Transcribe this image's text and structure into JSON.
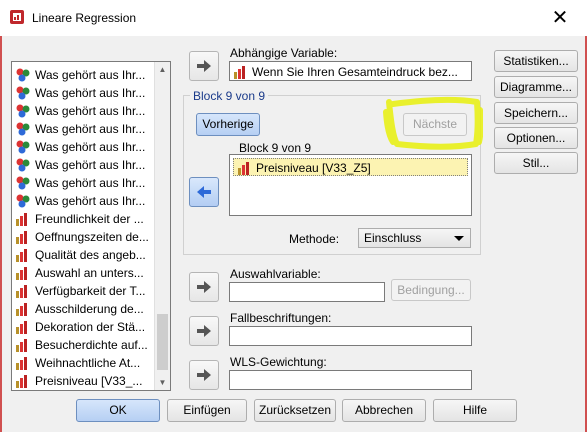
{
  "window": {
    "title": "Lineare Regression",
    "close_glyph": "✕"
  },
  "variable_list": {
    "items": [
      {
        "label": "Was gehört aus Ihr...",
        "icon": "ordinal-icon"
      },
      {
        "label": "Was gehört aus Ihr...",
        "icon": "ordinal-icon"
      },
      {
        "label": "Was gehört aus Ihr...",
        "icon": "ordinal-icon"
      },
      {
        "label": "Was gehört aus Ihr...",
        "icon": "ordinal-icon"
      },
      {
        "label": "Was gehört aus Ihr...",
        "icon": "ordinal-icon"
      },
      {
        "label": "Was gehört aus Ihr...",
        "icon": "ordinal-icon"
      },
      {
        "label": "Was gehört aus Ihr...",
        "icon": "ordinal-icon"
      },
      {
        "label": "Was gehört aus Ihr...",
        "icon": "ordinal-icon"
      },
      {
        "label": "Freundlichkeit der ...",
        "icon": "scale-icon"
      },
      {
        "label": "Oeffnungszeiten de...",
        "icon": "scale-icon"
      },
      {
        "label": "Qualität des angeb...",
        "icon": "scale-icon"
      },
      {
        "label": "Auswahl an unters...",
        "icon": "scale-icon"
      },
      {
        "label": "Verfügbarkeit  der T...",
        "icon": "scale-icon"
      },
      {
        "label": "Ausschilderung de...",
        "icon": "scale-icon"
      },
      {
        "label": "Dekoration der Stä...",
        "icon": "scale-icon"
      },
      {
        "label": "Besucherdichte auf...",
        "icon": "scale-icon"
      },
      {
        "label": "Weihnachtliche At...",
        "icon": "scale-icon"
      },
      {
        "label": "Preisniveau  [V33_...",
        "icon": "scale-icon"
      }
    ]
  },
  "dependent": {
    "label": "Abhängige Variable:",
    "value": "Wenn Sie Ihren Gesamteindruck bez...",
    "icon": "scale-icon"
  },
  "block": {
    "legend": "Block 9 von 9",
    "prev_label": "Vorherige",
    "next_label": "Nächste",
    "list_label": "Block 9 von 9",
    "selected_item": "Preisniveau  [V33_Z5]",
    "method_label": "Methode:",
    "method_value": "Einschluss"
  },
  "selection": {
    "label": "Auswahlvariable:",
    "value": "",
    "condition_label": "Bedingung..."
  },
  "case_labels": {
    "label": "Fallbeschriftungen:",
    "value": ""
  },
  "wls": {
    "label": "WLS-Gewichtung:",
    "value": ""
  },
  "side_buttons": [
    "Statistiken...",
    "Diagramme...",
    "Speichern...",
    "Optionen...",
    "Stil..."
  ],
  "bottom_buttons": [
    "OK",
    "Einfügen",
    "Zurücksetzen",
    "Abbrechen",
    "Hilfe"
  ],
  "colors": {
    "highlight": "#e8f00a",
    "accent_blue": "#2e6ad8",
    "selection_bg": "#fcf3b2"
  }
}
